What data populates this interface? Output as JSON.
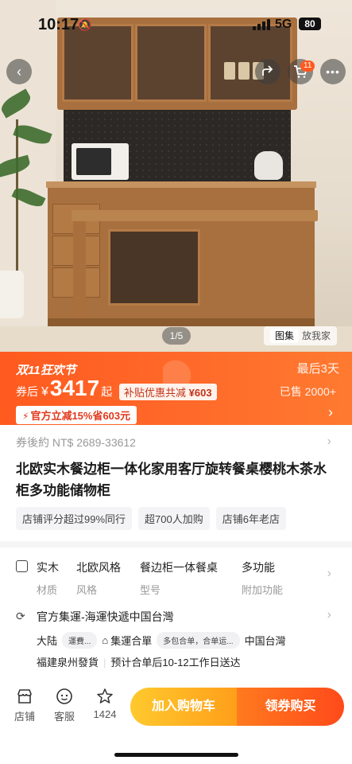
{
  "status_bar": {
    "time": "10:17",
    "network": "5G",
    "battery": "80"
  },
  "nav": {
    "back_icon": "chevron-left-icon",
    "share_icon": "share-icon",
    "cart_icon": "cart-icon",
    "cart_badge": "11",
    "more_icon": "more-icon"
  },
  "gallery": {
    "pager": "1/5",
    "tab_active": "图集",
    "tab_other": "放我家"
  },
  "promo": {
    "festival": "双11狂欢节",
    "countdown": "最后3天",
    "price_prefix": "券后",
    "currency": "¥",
    "price": "3417",
    "price_suffix": "起",
    "subsidy_label": "补贴优惠共减",
    "subsidy_amount": "¥603",
    "sold": "已售 2000+",
    "official_discount": "官方立减15%省603元"
  },
  "coupon_price": "券後約 NT$ 2689-33612",
  "title": "北欧实木餐边柜一体化家用客厅旋转餐桌樱桃木茶水柜多功能储物柜",
  "tags": [
    "店铺评分超过99%同行",
    "超700人加购",
    "店铺6年老店"
  ],
  "attributes": [
    {
      "value": "实木",
      "key": "材质"
    },
    {
      "value": "北欧风格",
      "key": "风格"
    },
    {
      "value": "餐边柜一体餐桌",
      "key": "型号"
    },
    {
      "value": "多功能",
      "key": "附加功能"
    }
  ],
  "shipping": {
    "title": "官方集運-海運快遞中国台灣",
    "origin": "大陆",
    "pill1": "運費...",
    "merge": "集運合單",
    "pill2": "多包合单，合单运...",
    "destination": "中国台灣",
    "from": "福建泉州發貨",
    "eta": "预计合单后10-12工作日送达"
  },
  "bottom_bar": {
    "shop": "店铺",
    "service": "客服",
    "favorites": "1424",
    "add_cart": "加入购物车",
    "buy": "领券购买"
  }
}
